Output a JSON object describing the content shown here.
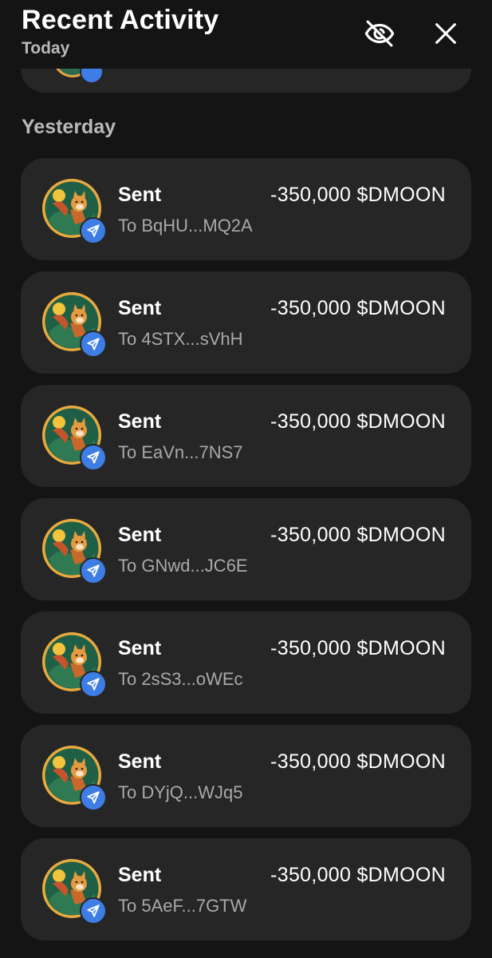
{
  "header": {
    "title": "Recent Activity",
    "subtitle": "Today",
    "hide_icon": "eye-off-icon",
    "close_icon": "close-icon"
  },
  "section": {
    "label": "Yesterday"
  },
  "transactions": [
    {
      "type": "Sent",
      "amount": "-350,000 $DMOON",
      "destination": "To BqHU...MQ2A"
    },
    {
      "type": "Sent",
      "amount": "-350,000 $DMOON",
      "destination": "To 4STX...sVhH"
    },
    {
      "type": "Sent",
      "amount": "-350,000 $DMOON",
      "destination": "To EaVn...7NS7"
    },
    {
      "type": "Sent",
      "amount": "-350,000 $DMOON",
      "destination": "To GNwd...JC6E"
    },
    {
      "type": "Sent",
      "amount": "-350,000 $DMOON",
      "destination": "To 2sS3...oWEc"
    },
    {
      "type": "Sent",
      "amount": "-350,000 $DMOON",
      "destination": "To DYjQ...WJq5"
    },
    {
      "type": "Sent",
      "amount": "-350,000 $DMOON",
      "destination": "To 5AeF...7GTW"
    }
  ],
  "colors": {
    "background": "#141414",
    "card": "#262626",
    "badge": "#3d7de4",
    "muted_text": "#a9a9a9"
  }
}
